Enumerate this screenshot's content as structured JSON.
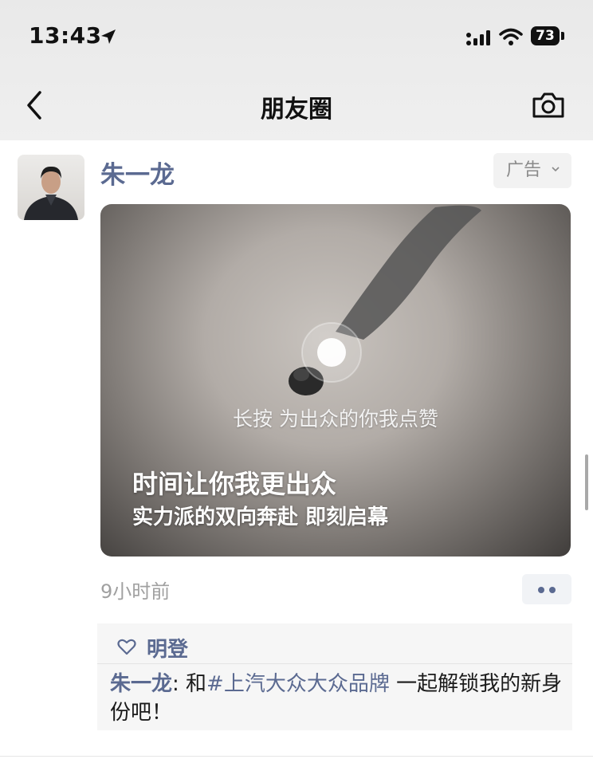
{
  "status_bar": {
    "time": "13:43",
    "battery": "73"
  },
  "nav": {
    "title": "朋友圈"
  },
  "post": {
    "author": "朱一龙",
    "ad_label": "广告",
    "media": {
      "hint": "长按 为出众的你我点赞",
      "headline": "时间让你我更出众",
      "subline": "实力派的双向奔赴 即刻启幕"
    },
    "time_ago": "9小时前",
    "likes": {
      "names": "明登"
    },
    "comment": {
      "author": "朱一龙",
      "sep": ": 和",
      "tag": "#上汽大众大众品牌",
      "text": " 一起解锁我的新身份吧！"
    }
  },
  "colors": {
    "link": "#5b6a91",
    "meta": "#a0a0a0",
    "header_bg": "#ececec"
  },
  "icons": [
    "location-arrow-icon",
    "signal-icon",
    "wifi-icon",
    "back-chevron-icon",
    "camera-icon",
    "chevron-down-icon",
    "heart-icon",
    "more-dots-icon"
  ]
}
